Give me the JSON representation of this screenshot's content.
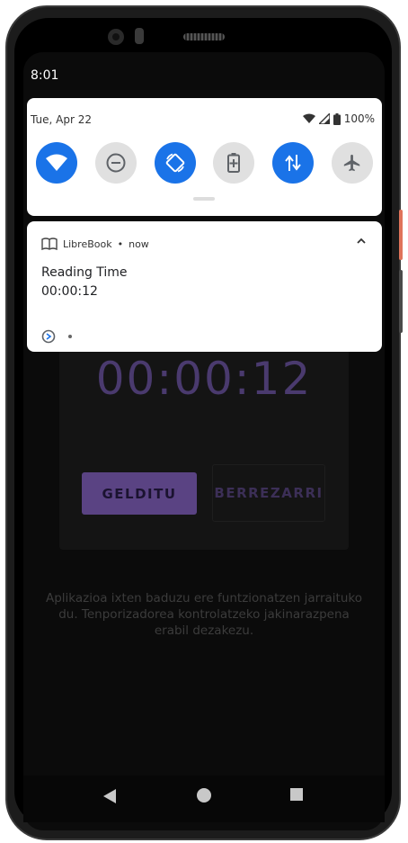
{
  "status_bar": {
    "time": "8:01"
  },
  "quick_settings": {
    "date": "Tue, Apr 22",
    "battery": "100%",
    "tiles": [
      {
        "icon": "wifi-icon",
        "state": "on"
      },
      {
        "icon": "do-not-disturb-icon",
        "state": "off"
      },
      {
        "icon": "auto-rotate-icon",
        "state": "on"
      },
      {
        "icon": "battery-saver-icon",
        "state": "off"
      },
      {
        "icon": "mobile-data-icon",
        "state": "on"
      },
      {
        "icon": "airplane-mode-icon",
        "state": "off"
      }
    ]
  },
  "notification": {
    "app_name": "LibreBook",
    "separator": "•",
    "time": "now",
    "title": "Reading Time",
    "text": "00:00:12"
  },
  "app": {
    "timer": "00:00:12",
    "stop_label": "GELDITU",
    "reset_label": "BERREZARRI",
    "info": "Aplikazioa ixten baduzu ere funtzionatzen jarraituko du. Tenporizadorea kontrolatzeko jakinarazpena erabil dezakezu."
  },
  "colors": {
    "accent": "#1a73e8",
    "primary_purple": "#5a4383",
    "timer_purple": "#4a3a6e"
  }
}
